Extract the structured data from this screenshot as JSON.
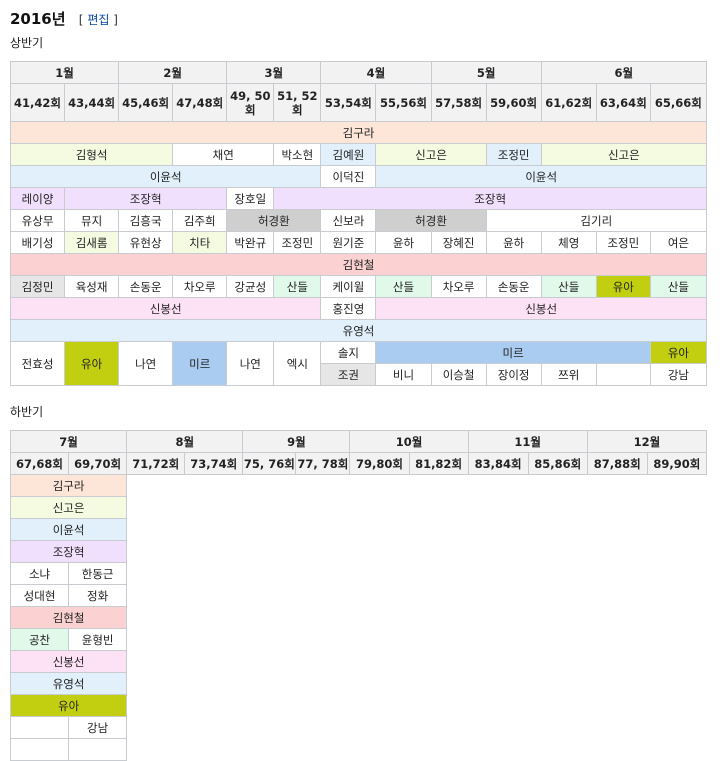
{
  "page": {
    "title": "2016년",
    "edit_open": "[",
    "edit_label": "편집",
    "edit_close": "]"
  },
  "h1": {
    "label": "상반기",
    "months": [
      "1월",
      "2월",
      "3월",
      "4월",
      "5월",
      "6월"
    ],
    "eps": [
      "41,42회",
      "43,44회",
      "45,46회",
      "47,48회",
      "49, 50회",
      "51, 52회",
      "53,54회",
      "55,56회",
      "57,58회",
      "59,60회",
      "61,62회",
      "63,64회",
      "65,66회"
    ],
    "colors": {
      "peach": "#fde5d8",
      "lime": "#f5fbe1",
      "blue": "#e1f0fb",
      "lilac": "#f1e0fd",
      "gray": "#cfcfcf",
      "lgray": "#e6e6e6",
      "red": "#fbd1d1",
      "mint": "#e1f9e8",
      "olive": "#c1cf10",
      "pink": "#fde1f5",
      "sky": "#a9ccf0",
      "white": "#ffffff"
    },
    "rows": [
      [
        {
          "t": "김구라",
          "s": 13,
          "c": "peach"
        }
      ],
      [
        {
          "t": "김형석",
          "s": 3,
          "c": "lime"
        },
        {
          "t": "채연",
          "s": 2,
          "c": "white"
        },
        {
          "t": "박소현",
          "s": 1,
          "c": "white"
        },
        {
          "t": "김예원",
          "s": 1,
          "c": "blue"
        },
        {
          "t": "신고은",
          "s": 2,
          "c": "lime"
        },
        {
          "t": "조정민",
          "s": 1,
          "c": "blue"
        },
        {
          "t": "신고은",
          "s": 3,
          "c": "lime"
        }
      ],
      [
        {
          "t": "이윤석",
          "s": 6,
          "c": "blue"
        },
        {
          "t": "이덕진",
          "s": 1,
          "c": "white"
        },
        {
          "t": "이윤석",
          "s": 6,
          "c": "blue"
        }
      ],
      [
        {
          "t": "레이양",
          "s": 1,
          "c": "lilac"
        },
        {
          "t": "조장혁",
          "s": 3,
          "c": "lilac"
        },
        {
          "t": "장호일",
          "s": 1,
          "c": "white"
        },
        {
          "t": "조장혁",
          "s": 8,
          "c": "lilac"
        }
      ],
      [
        {
          "t": "유상무",
          "s": 1,
          "c": "white"
        },
        {
          "t": "뮤지",
          "s": 1,
          "c": "white"
        },
        {
          "t": "김흥국",
          "s": 1,
          "c": "white"
        },
        {
          "t": "김주희",
          "s": 1,
          "c": "white"
        },
        {
          "t": "허경환",
          "s": 2,
          "c": "gray"
        },
        {
          "t": "신보라",
          "s": 1,
          "c": "white"
        },
        {
          "t": "허경환",
          "s": 2,
          "c": "gray"
        },
        {
          "t": "김기리",
          "s": 4,
          "c": "white"
        }
      ],
      [
        {
          "t": "배기성",
          "s": 1,
          "c": "white"
        },
        {
          "t": "김새롬",
          "s": 1,
          "c": "lime"
        },
        {
          "t": "유현상",
          "s": 1,
          "c": "white"
        },
        {
          "t": "치타",
          "s": 1,
          "c": "lime"
        },
        {
          "t": "박완규",
          "s": 1,
          "c": "white"
        },
        {
          "t": "조정민",
          "s": 1,
          "c": "white"
        },
        {
          "t": "원기준",
          "s": 1,
          "c": "white"
        },
        {
          "t": "윤하",
          "s": 1,
          "c": "white"
        },
        {
          "t": "장혜진",
          "s": 1,
          "c": "white"
        },
        {
          "t": "윤하",
          "s": 1,
          "c": "white"
        },
        {
          "t": "체영",
          "s": 1,
          "c": "white"
        },
        {
          "t": "조정민",
          "s": 1,
          "c": "white"
        },
        {
          "t": "여은",
          "s": 1,
          "c": "white"
        }
      ],
      [
        {
          "t": "김현철",
          "s": 13,
          "c": "red"
        }
      ],
      [
        {
          "t": "김정민",
          "s": 1,
          "c": "lgray"
        },
        {
          "t": "육성재",
          "s": 1,
          "c": "white"
        },
        {
          "t": "손동운",
          "s": 1,
          "c": "white"
        },
        {
          "t": "차오루",
          "s": 1,
          "c": "white"
        },
        {
          "t": "강균성",
          "s": 1,
          "c": "white"
        },
        {
          "t": "산들",
          "s": 1,
          "c": "mint"
        },
        {
          "t": "케이윌",
          "s": 1,
          "c": "white"
        },
        {
          "t": "산들",
          "s": 1,
          "c": "mint"
        },
        {
          "t": "차오루",
          "s": 1,
          "c": "white"
        },
        {
          "t": "손동운",
          "s": 1,
          "c": "white"
        },
        {
          "t": "산들",
          "s": 1,
          "c": "mint"
        },
        {
          "t": "유아",
          "s": 1,
          "c": "olive"
        },
        {
          "t": "산들",
          "s": 1,
          "c": "mint"
        }
      ],
      [
        {
          "t": "신봉선",
          "s": 6,
          "c": "pink"
        },
        {
          "t": "홍진영",
          "s": 1,
          "c": "white"
        },
        {
          "t": "신봉선",
          "s": 6,
          "c": "pink"
        }
      ],
      [
        {
          "t": "유영석",
          "s": 13,
          "c": "blue"
        }
      ],
      [
        {
          "t": "전효성",
          "s": 1,
          "c": "white",
          "r": 2
        },
        {
          "t": "유아",
          "s": 1,
          "c": "olive",
          "r": 2
        },
        {
          "t": "나연",
          "s": 1,
          "c": "white",
          "r": 2
        },
        {
          "t": "미르",
          "s": 1,
          "c": "sky",
          "r": 2
        },
        {
          "t": "나연",
          "s": 1,
          "c": "white",
          "r": 2
        },
        {
          "t": "엑시",
          "s": 1,
          "c": "white",
          "r": 2
        },
        {
          "t": "솔지",
          "s": 1,
          "c": "white"
        },
        {
          "t": "미르",
          "s": 5,
          "c": "sky"
        },
        {
          "t": "유아",
          "s": 1,
          "c": "olive"
        }
      ],
      [
        {
          "t": "조권",
          "s": 1,
          "c": "lgray"
        },
        {
          "t": "비니",
          "s": 1,
          "c": "white"
        },
        {
          "t": "이승철",
          "s": 1,
          "c": "white"
        },
        {
          "t": "장이정",
          "s": 1,
          "c": "white"
        },
        {
          "t": "쯔위",
          "s": 1,
          "c": "white"
        },
        {
          "t": "",
          "s": 1,
          "c": "white"
        },
        {
          "t": "강남",
          "s": 1,
          "c": "white"
        }
      ]
    ]
  },
  "h2": {
    "label": "하반기",
    "months": [
      "7월",
      "8월",
      "9월",
      "10월",
      "11월",
      "12월"
    ],
    "eps": [
      "67,68회",
      "69,70회",
      "71,72회",
      "73,74회",
      "75, 76회",
      "77, 78회",
      "79,80회",
      "81,82회",
      "83,84회",
      "85,86회",
      "87,88회",
      "89,90회"
    ],
    "rows": [
      [
        {
          "t": "김구라",
          "s": 2,
          "c": "peach"
        }
      ],
      [
        {
          "t": "신고은",
          "s": 2,
          "c": "lime"
        }
      ],
      [
        {
          "t": "이윤석",
          "s": 2,
          "c": "blue"
        }
      ],
      [
        {
          "t": "조장혁",
          "s": 2,
          "c": "lilac"
        }
      ],
      [
        {
          "t": "소냐",
          "s": 1,
          "c": "white"
        },
        {
          "t": "한동근",
          "s": 1,
          "c": "white"
        }
      ],
      [
        {
          "t": "성대현",
          "s": 1,
          "c": "white"
        },
        {
          "t": "정화",
          "s": 1,
          "c": "white"
        }
      ],
      [
        {
          "t": "김현철",
          "s": 2,
          "c": "red"
        }
      ],
      [
        {
          "t": "공찬",
          "s": 1,
          "c": "mint"
        },
        {
          "t": "윤형빈",
          "s": 1,
          "c": "white"
        }
      ],
      [
        {
          "t": "신봉선",
          "s": 2,
          "c": "pink"
        }
      ],
      [
        {
          "t": "유영석",
          "s": 2,
          "c": "blue"
        }
      ],
      [
        {
          "t": "유아",
          "s": 2,
          "c": "olive"
        }
      ],
      [
        {
          "t": "",
          "s": 1,
          "c": "white"
        },
        {
          "t": "강남",
          "s": 1,
          "c": "white"
        }
      ],
      [
        {
          "t": "",
          "s": 1,
          "c": "white"
        },
        {
          "t": "",
          "s": 1,
          "c": "white"
        }
      ]
    ]
  }
}
